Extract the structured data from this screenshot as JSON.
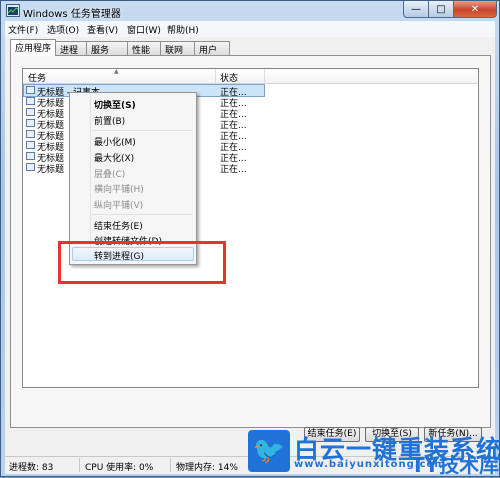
{
  "window": {
    "title": "Windows 任务管理器",
    "minimize_glyph": "—",
    "maximize_glyph": "□",
    "close_glyph": "✕"
  },
  "menubar": {
    "items": [
      "文件(F)",
      "选项(O)",
      "查看(V)",
      "窗口(W)",
      "帮助(H)"
    ]
  },
  "tabs": {
    "items": [
      "应用程序",
      "进程",
      "服务",
      "性能",
      "联网",
      "用户"
    ],
    "active": "应用程序"
  },
  "list": {
    "columns": {
      "task": "任务",
      "status": "状态"
    },
    "sort_indicator": "▲",
    "rows": [
      {
        "name": "无标题 - 记事本",
        "status": "正在..."
      },
      {
        "name": "无标题",
        "status": "正在..."
      },
      {
        "name": "无标题",
        "status": "正在..."
      },
      {
        "name": "无标题",
        "status": "正在..."
      },
      {
        "name": "无标题",
        "status": "正在..."
      },
      {
        "name": "无标题",
        "status": "正在..."
      },
      {
        "name": "无标题",
        "status": "正在..."
      },
      {
        "name": "无标题",
        "status": "正在..."
      }
    ]
  },
  "context_menu": {
    "switch_to": "切换至(S)",
    "bring_front": "前置(B)",
    "minimize": "最小化(M)",
    "maximize": "最大化(X)",
    "cascade": "层叠(C)",
    "tile_horizontal": "横向平铺(H)",
    "tile_vertical": "纵向平铺(V)",
    "end_task": "结束任务(E)",
    "create_dump": "创建转储文件(D)",
    "go_to_process": "转到进程(G)"
  },
  "buttons": {
    "end_task": "结束任务(E)",
    "switch_to": "切换至(S)",
    "new_task": "新任务(N)..."
  },
  "statusbar": {
    "processes": "进程数: 83",
    "cpu": "CPU 使用率: 0%",
    "memory": "物理内存: 14%"
  },
  "watermark": {
    "title": "白云一键重装系统",
    "url": "www.baiyunxitong.com",
    "brand": "TY技术库"
  },
  "colors": {
    "annotation": "#e53232",
    "selection": "#cce4f7",
    "watermark": "#1f73d8"
  }
}
